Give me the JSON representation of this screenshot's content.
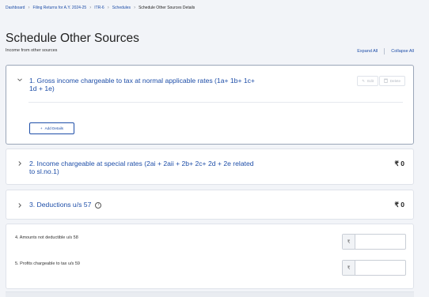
{
  "breadcrumb": {
    "items": [
      {
        "label": "Dashboard"
      },
      {
        "label": "Filing Returns for A.Y. 2024-25"
      },
      {
        "label": "ITR-6"
      },
      {
        "label": "Schedules"
      },
      {
        "label": "Schedule Other Sources Details"
      }
    ],
    "separator": "›"
  },
  "page": {
    "title": "Schedule Other Sources",
    "subtitle": "Income from other sources",
    "expand_all": "Expand All",
    "collapse_all": "Collapse All"
  },
  "sections": [
    {
      "number_title": "1. Gross income chargeable to tax at normal applicable rates (1a+ 1b+ 1c+ 1d + 1e)",
      "line1": "1. Gross income chargeable to tax at normal applicable rates (1a+ 1b+ 1c+",
      "line2": "1d + 1e)",
      "expanded": true,
      "chevron": "chevron-down-icon",
      "edit_label": "Edit",
      "delete_label": "Delete",
      "add_label": "Add Details"
    },
    {
      "line1": "2. Income chargeable at special rates (2ai + 2aii + 2b+ 2c+ 2d + 2e related",
      "line2": "to sl.no.1)",
      "expanded": false,
      "chevron": "chevron-right-icon",
      "amount": "₹ 0"
    },
    {
      "line1": "3. Deductions u/s 57",
      "expanded": false,
      "chevron": "chevron-right-icon",
      "info_icon": "info-icon",
      "amount": "₹ 0"
    }
  ],
  "fields": [
    {
      "label": "4. Amounts not deductible u/s 58",
      "currency": "₹",
      "value": ""
    },
    {
      "label": "5. Profits chargeable to tax u/s 59",
      "currency": "₹",
      "value": ""
    }
  ],
  "colors": {
    "link": "#1e4ea8",
    "background": "#f2f4f8",
    "card": "#ffffff",
    "border": "#dfe3ea"
  }
}
